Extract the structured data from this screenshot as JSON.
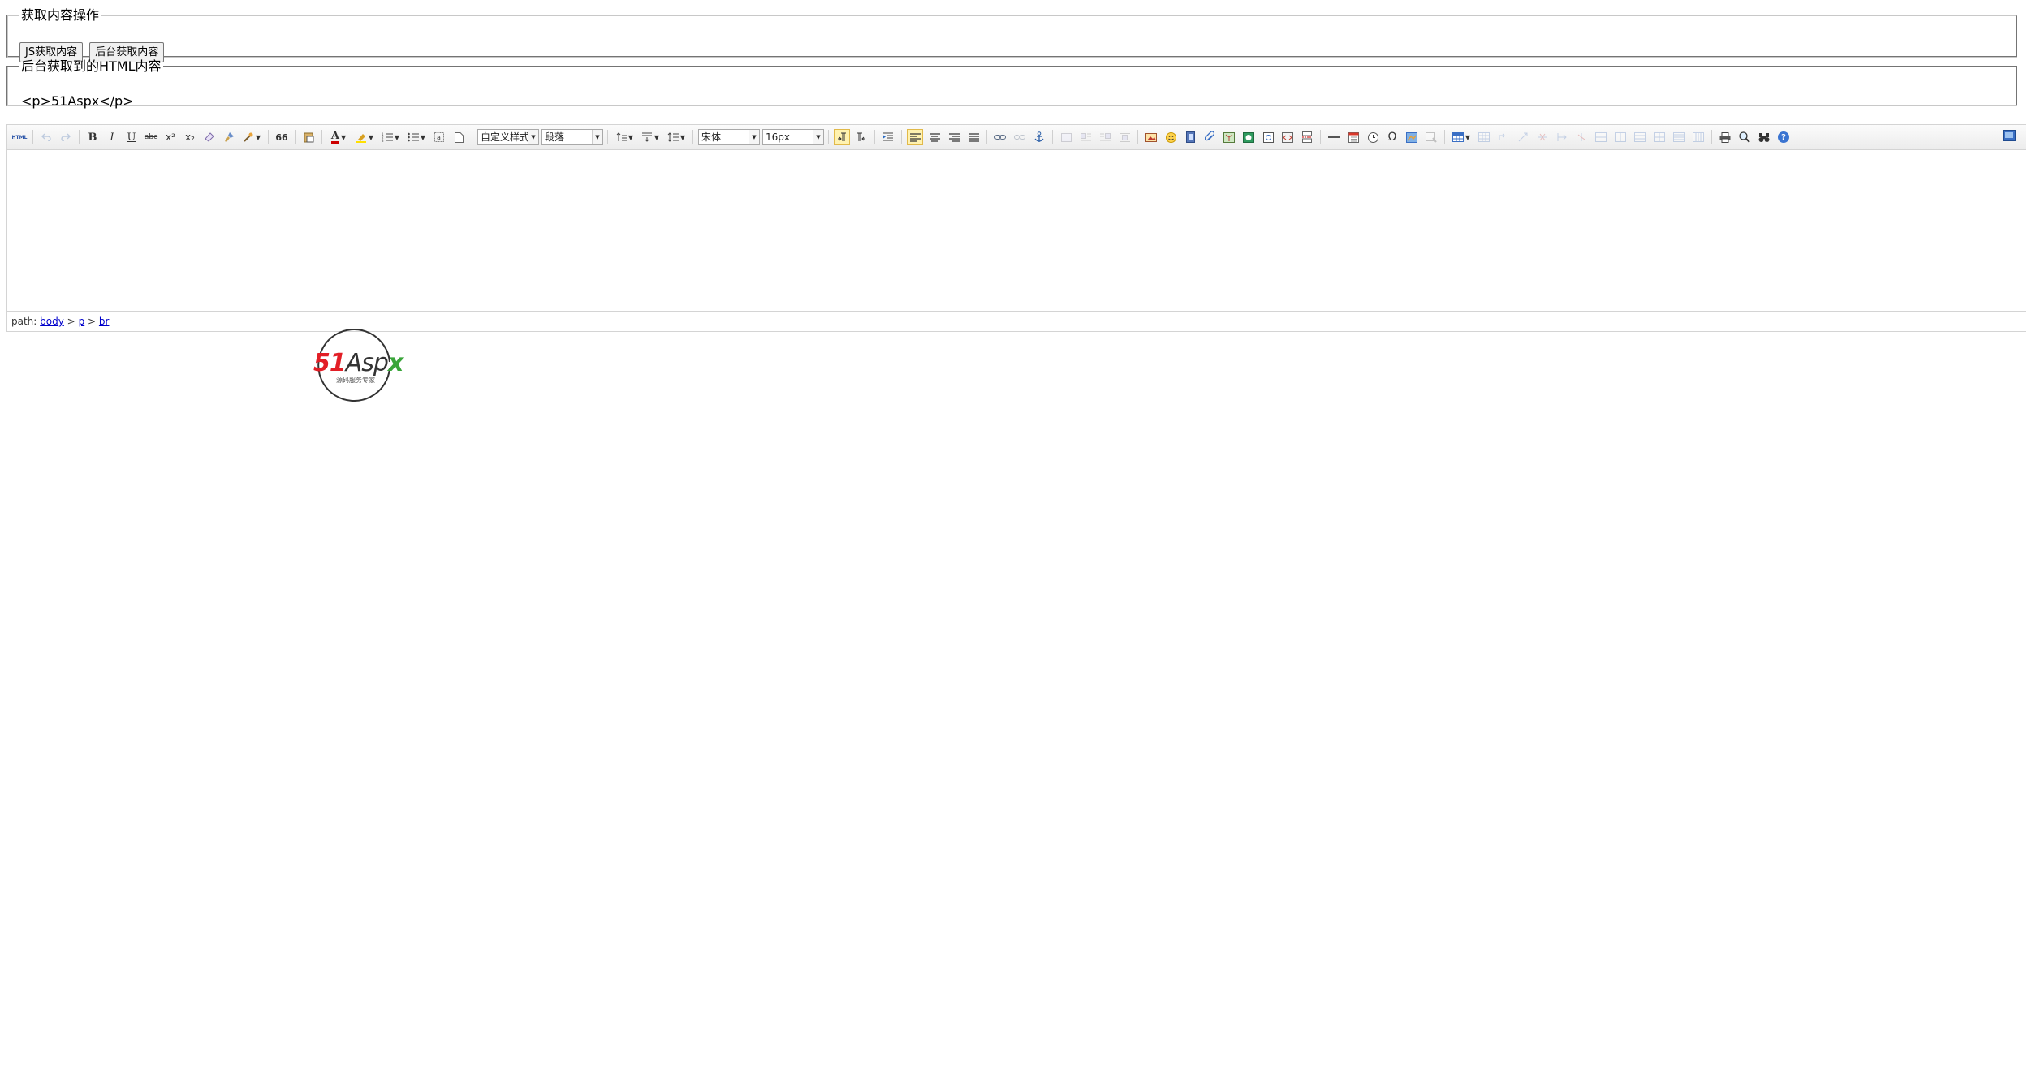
{
  "ops": {
    "legend": "获取内容操作",
    "js_button": "JS获取内容",
    "server_button": "后台获取内容"
  },
  "html_output": {
    "legend": "后台获取到的HTML内容",
    "content": "<p>51Aspx</p>"
  },
  "toolbar": {
    "source_label": "HTML",
    "bold": "B",
    "italic": "I",
    "underline": "U",
    "strike": "abc",
    "superscript": "x²",
    "subscript": "x₂",
    "blockquote": "66",
    "forecolor": "A",
    "customstyle": "自定义样式",
    "paragraph": "段落",
    "fontfamily": "宋体",
    "fontsize": "16px",
    "omega": "Ω",
    "help": "?"
  },
  "pathbar": {
    "prefix": "path:",
    "items": [
      "body",
      "p",
      "br"
    ],
    "sep": ">"
  },
  "logo": {
    "brand_red": "51",
    "brand_black": "Asp",
    "brand_green": "x",
    "tagline": "源码服务专家",
    "colors": {
      "red": "#e21e26",
      "green": "#3aa53a",
      "ring": "#333333"
    }
  }
}
